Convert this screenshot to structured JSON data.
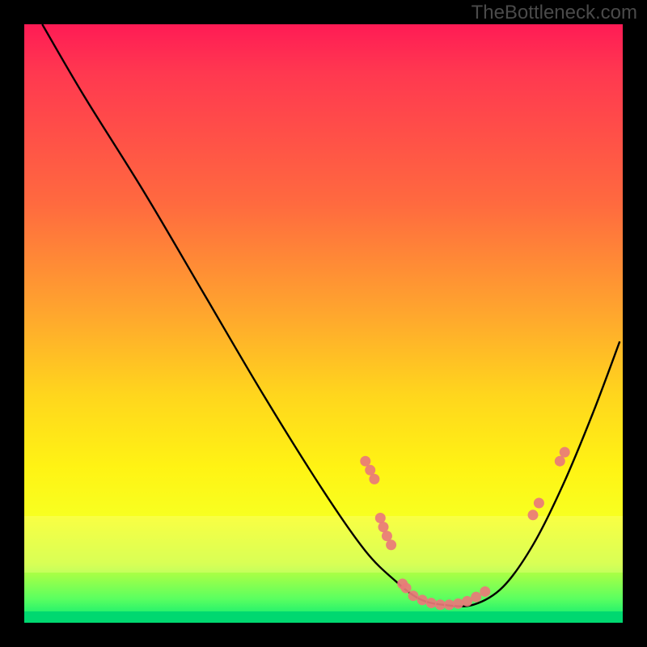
{
  "watermark": "TheBottleneck.com",
  "chart_data": {
    "type": "line",
    "title": "",
    "xlabel": "",
    "ylabel": "",
    "xlim": [
      0,
      100
    ],
    "ylim": [
      0,
      100
    ],
    "series": [
      {
        "name": "curve",
        "x": [
          3,
          10,
          20,
          30,
          40,
          50,
          57,
          62,
          66,
          70,
          75,
          80,
          85,
          90,
          95,
          99.5
        ],
        "y": [
          100,
          88,
          72,
          55,
          38,
          22,
          12,
          7,
          4,
          3,
          3,
          6,
          13,
          23,
          35,
          47
        ]
      }
    ],
    "markers": {
      "name": "data-points",
      "color": "#e97a7a",
      "points": [
        {
          "x": 57.0,
          "y": 27.0
        },
        {
          "x": 57.8,
          "y": 25.5
        },
        {
          "x": 58.5,
          "y": 24.0
        },
        {
          "x": 59.5,
          "y": 17.5
        },
        {
          "x": 60.0,
          "y": 16.0
        },
        {
          "x": 60.6,
          "y": 14.5
        },
        {
          "x": 61.3,
          "y": 13.0
        },
        {
          "x": 63.2,
          "y": 6.5
        },
        {
          "x": 63.8,
          "y": 5.8
        },
        {
          "x": 65.0,
          "y": 4.5
        },
        {
          "x": 66.5,
          "y": 3.8
        },
        {
          "x": 68.0,
          "y": 3.3
        },
        {
          "x": 69.5,
          "y": 3.0
        },
        {
          "x": 71.0,
          "y": 3.0
        },
        {
          "x": 72.5,
          "y": 3.2
        },
        {
          "x": 74.0,
          "y": 3.6
        },
        {
          "x": 75.5,
          "y": 4.3
        },
        {
          "x": 77.0,
          "y": 5.2
        },
        {
          "x": 85.0,
          "y": 18.0
        },
        {
          "x": 86.0,
          "y": 20.0
        },
        {
          "x": 89.5,
          "y": 27.0
        },
        {
          "x": 90.3,
          "y": 28.5
        }
      ]
    },
    "gradient_stops": [
      {
        "pos": 0.0,
        "color": "#ff1b55"
      },
      {
        "pos": 0.3,
        "color": "#ff6a3f"
      },
      {
        "pos": 0.62,
        "color": "#ffd61d"
      },
      {
        "pos": 0.82,
        "color": "#f8ff20"
      },
      {
        "pos": 1.0,
        "color": "#00e876"
      }
    ]
  }
}
